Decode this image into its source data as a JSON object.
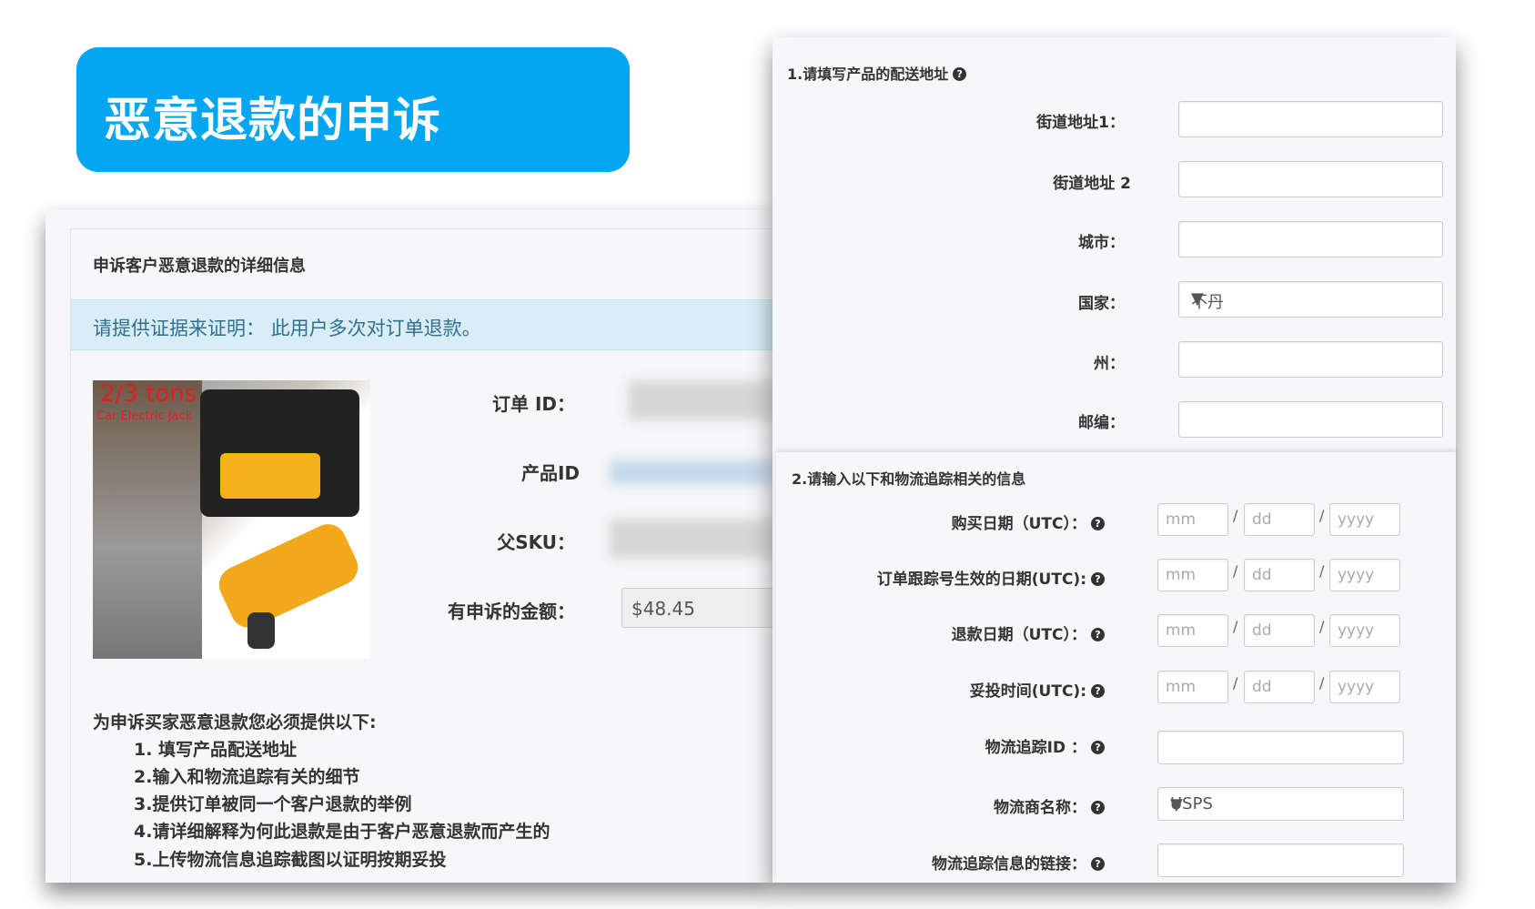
{
  "banner": {
    "title": "恶意退款的申诉"
  },
  "left": {
    "heading": "申诉客户恶意退款的详细信息",
    "alert": "请提供证据来证明： 此用户多次对订单退款。",
    "image_text": {
      "line1": "2/3 tons",
      "line2": "Car Electric Jack"
    },
    "fields": {
      "order_id": "订单 ID：",
      "product_id": "产品ID",
      "parent_sku": "父SKU：",
      "amount_label": "有申诉的金额：",
      "amount_value": "$48.45"
    },
    "instructions": {
      "title": "为申诉买家恶意退款您必须提供以下:",
      "items": [
        "1. 填写产品配送地址",
        "2.输入和物流追踪有关的细节",
        "3.提供订单被同一个客户退款的举例",
        "4.请详细解释为何此退款是由于客户恶意退款而产生的",
        "5.上传物流信息追踪截图以证明按期妥投"
      ]
    }
  },
  "address": {
    "title": "1.请填写产品的配送地址",
    "street1": "街道地址1：",
    "street2": "街道地址 2",
    "city": "城市：",
    "country": "国家：",
    "country_value": "不丹",
    "state": "州：",
    "zip": "邮编："
  },
  "tracking": {
    "title": "2.请输入以下和物流追踪相关的信息",
    "dates": [
      {
        "label": "购买日期（UTC）："
      },
      {
        "label": "订单跟踪号生效的日期(UTC):"
      },
      {
        "label": "退款日期（UTC）："
      },
      {
        "label": "妥投时间(UTC):"
      }
    ],
    "placeholders": {
      "mm": "mm",
      "dd": "dd",
      "yyyy": "yyyy"
    },
    "tracking_id": "物流追踪ID ：",
    "carrier": "物流商名称：",
    "carrier_value": "USPS",
    "link": "物流追踪信息的链接：",
    "slash": "/",
    "help": "?",
    "arrow": "▼"
  }
}
